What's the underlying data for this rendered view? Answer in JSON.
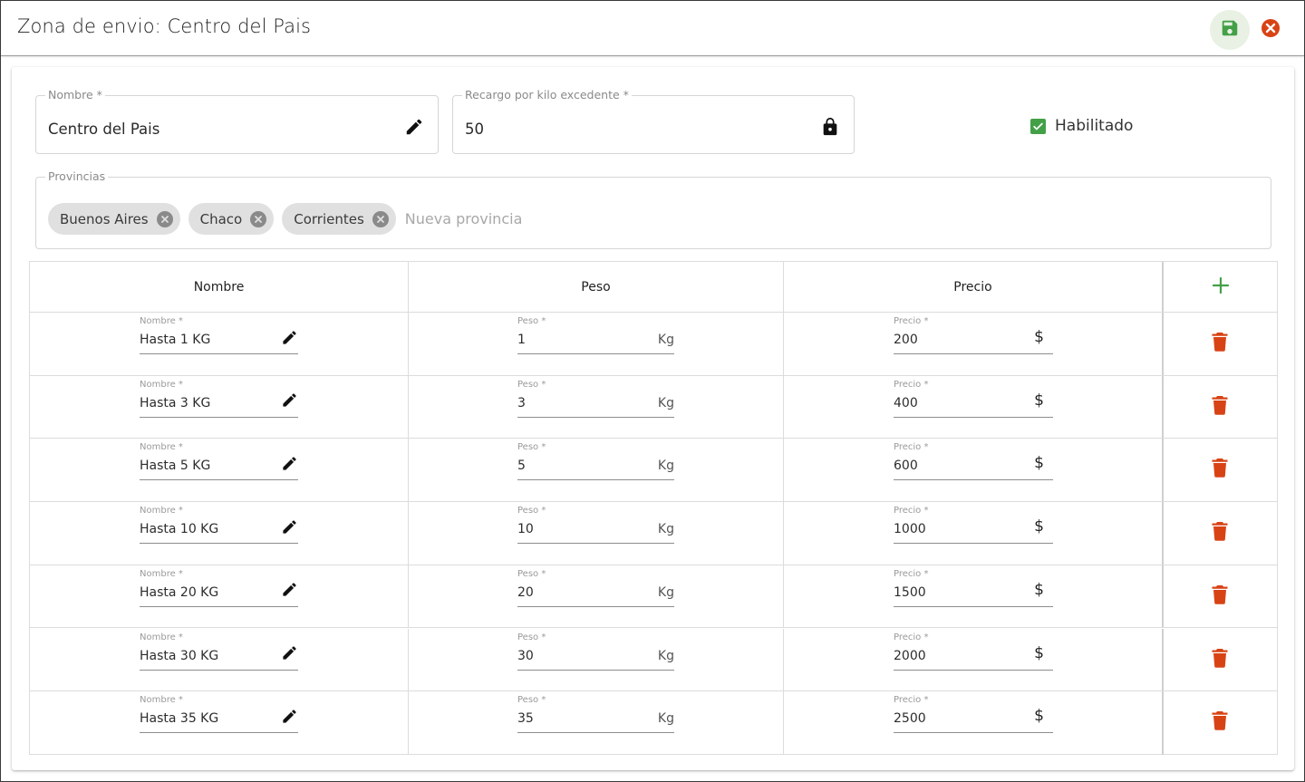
{
  "header": {
    "title": "Zona de envio: Centro del Pais",
    "save_icon": "floppy-disk-icon",
    "close_icon": "close-circle-icon",
    "colors": {
      "save": "#43a047",
      "close": "#d84315"
    }
  },
  "form": {
    "nombre": {
      "label": "Nombre *",
      "value": "Centro del Pais",
      "icon": "pencil-icon"
    },
    "recargo": {
      "label": "Recargo por kilo excedente *",
      "value": "50",
      "icon": "lock-icon"
    },
    "habilitado": {
      "label": "Habilitado",
      "checked": true
    },
    "provincias": {
      "label": "Provincias",
      "chips": [
        "Buenos Aires",
        "Chaco",
        "Corrientes"
      ],
      "placeholder": "Nueva provincia"
    }
  },
  "table": {
    "headers": {
      "nombre": "Nombre",
      "peso": "Peso",
      "precio": "Precio"
    },
    "add_icon": "plus-icon",
    "field_labels": {
      "nombre": "Nombre *",
      "peso": "Peso *",
      "precio": "Precio *"
    },
    "peso_suffix": "Kg",
    "precio_suffix": "$",
    "rows": [
      {
        "nombre": "Hasta 1 KG",
        "peso": "1",
        "precio": "200"
      },
      {
        "nombre": "Hasta 3 KG",
        "peso": "3",
        "precio": "400"
      },
      {
        "nombre": "Hasta 5 KG",
        "peso": "5",
        "precio": "600"
      },
      {
        "nombre": "Hasta 10 KG",
        "peso": "10",
        "precio": "1000"
      },
      {
        "nombre": "Hasta 20 KG",
        "peso": "20",
        "precio": "1500"
      },
      {
        "nombre": "Hasta 30 KG",
        "peso": "30",
        "precio": "2000"
      },
      {
        "nombre": "Hasta 35 KG",
        "peso": "35",
        "precio": "2500"
      }
    ]
  }
}
